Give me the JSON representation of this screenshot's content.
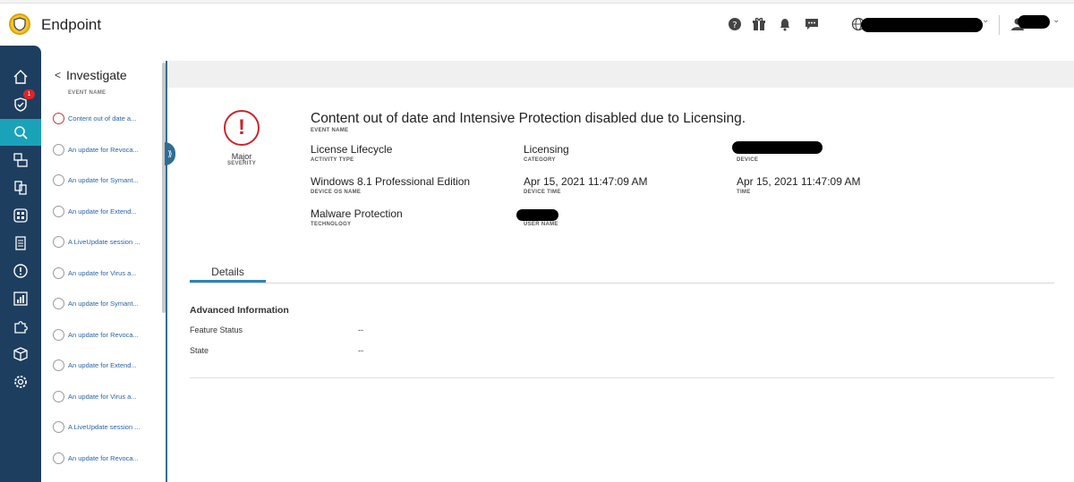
{
  "app": {
    "title": "Endpoint"
  },
  "rail": [
    {
      "name": "home-icon"
    },
    {
      "name": "shield-icon",
      "badge": "1"
    },
    {
      "name": "search-icon",
      "active": true
    },
    {
      "name": "devices-icon"
    },
    {
      "name": "copy-icon"
    },
    {
      "name": "apps-icon"
    },
    {
      "name": "list-icon"
    },
    {
      "name": "alert-icon"
    },
    {
      "name": "chart-icon"
    },
    {
      "name": "puzzle-icon"
    },
    {
      "name": "box-icon"
    },
    {
      "name": "gear-icon"
    }
  ],
  "panel": {
    "title": "Investigate",
    "column": "EVENT NAME",
    "items": [
      "Content out of date a...",
      "An update for Revoca...",
      "An update for Symant...",
      "An update for Extend...",
      "A LiveUpdate session ...",
      "An update for Virus a...",
      "An update for Symant...",
      "An update for Revoca...",
      "An update for Extend...",
      "An update for Virus a...",
      "A LiveUpdate session ...",
      "An update for Revoca..."
    ]
  },
  "event": {
    "severity_value": "Major",
    "severity_label": "SEVERITY",
    "name_value": "Content out of date and Intensive Protection disabled due to Licensing.",
    "name_label": "EVENT NAME",
    "activity_type_value": "License Lifecycle",
    "activity_type_label": "ACTIVITY TYPE",
    "category_value": "Licensing",
    "category_label": "CATEGORY",
    "device_label": "DEVICE",
    "os_value": "Windows 8.1 Professional Edition",
    "os_label": "DEVICE OS NAME",
    "device_time_value": "Apr 15, 2021 11:47:09 AM",
    "device_time_label": "DEVICE TIME",
    "time_value": "Apr 15, 2021 11:47:09 AM",
    "time_label": "TIME",
    "technology_value": "Malware Protection",
    "technology_label": "TECHNOLOGY",
    "user_label": "USER NAME"
  },
  "details": {
    "tab": "Details",
    "section": "Advanced Information",
    "rows": [
      {
        "label": "Feature Status",
        "value": "--"
      },
      {
        "label": "State",
        "value": "--"
      }
    ]
  },
  "colors": {
    "rail": "#1e3e5f",
    "active": "#1aa3b8",
    "severity": "#c8262c",
    "link": "#2b64a3"
  }
}
